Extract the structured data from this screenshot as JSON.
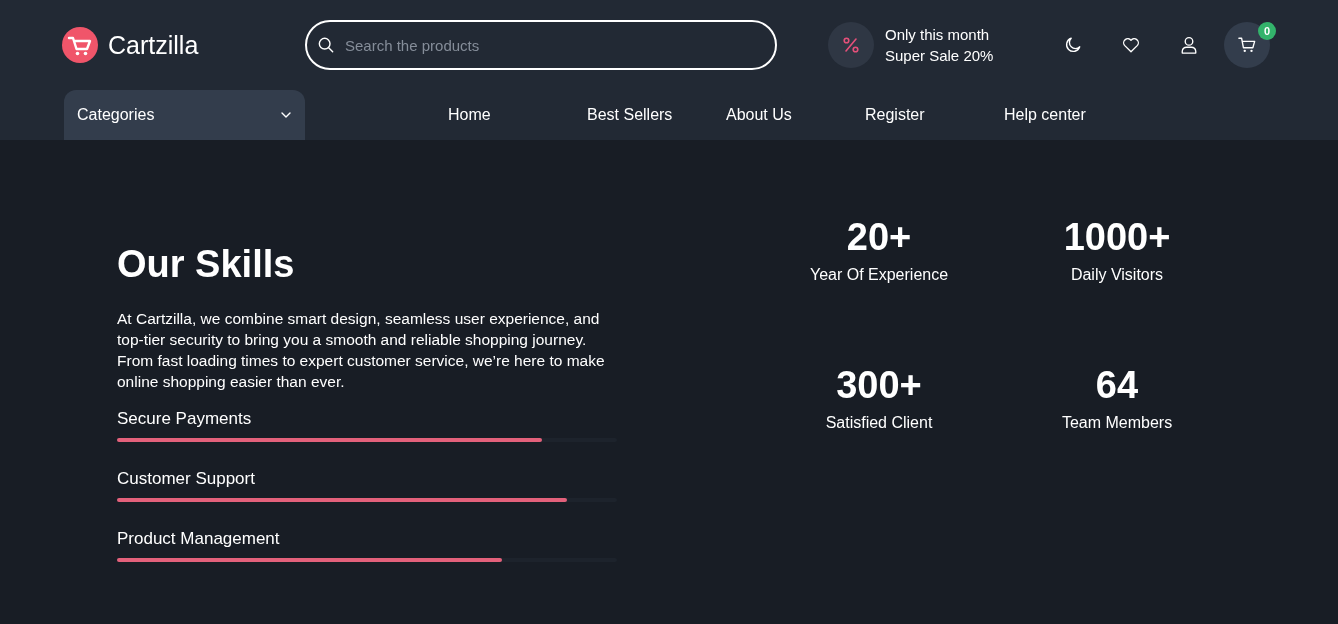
{
  "header": {
    "logo": {
      "name": "Cartzilla"
    },
    "search": {
      "placeholder": "Search the products"
    },
    "promo": {
      "lines": [
        "Only this month",
        "Super Sale 20%"
      ]
    },
    "cart": {
      "badge": "0"
    }
  },
  "nav": {
    "categories": {
      "label": "Categories"
    },
    "links": [
      {
        "label": "Home"
      },
      {
        "label": "Best Sellers"
      },
      {
        "label": "About Us"
      },
      {
        "label": "Register"
      },
      {
        "label": "Help center"
      }
    ]
  },
  "skills": {
    "title": "Our Skills",
    "description": "At Cartzilla, we combine smart design, seamless user experience, and top-tier security to bring you a smooth and reliable shopping journey. From fast loading times to expert customer service, we’re here to make online shopping easier than ever.",
    "bars": [
      {
        "label": "Secure Payments",
        "level": 0.85
      },
      {
        "label": "Customer Support",
        "level": 0.9
      },
      {
        "label": "Product Management",
        "level": 0.77
      }
    ]
  },
  "stats": [
    {
      "value": "20+",
      "label": "Year Of Experience"
    },
    {
      "value": "1000+",
      "label": "Daily Visitors"
    },
    {
      "value": "300+",
      "label": "Satisfied Client"
    },
    {
      "value": "64",
      "label": "Team Members"
    }
  ]
}
